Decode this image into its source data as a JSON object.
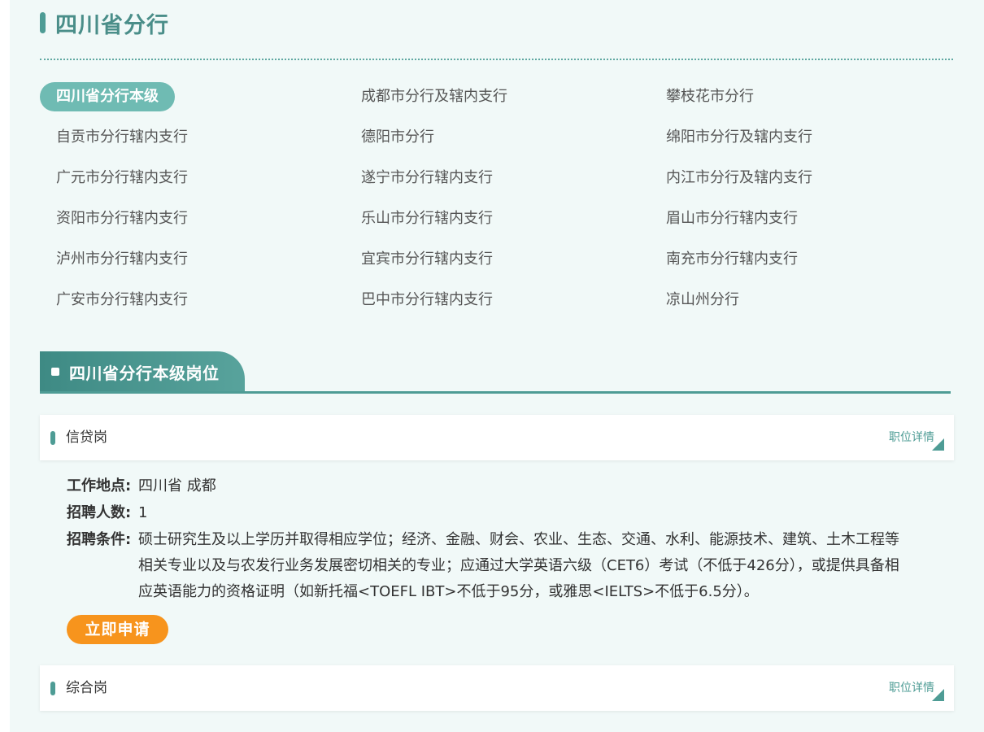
{
  "header": {
    "title": "四川省分行"
  },
  "branches": [
    {
      "label": "四川省分行本级",
      "active": true
    },
    {
      "label": "成都市分行及辖内支行"
    },
    {
      "label": "攀枝花市分行"
    },
    {
      "label": "自贡市分行辖内支行"
    },
    {
      "label": "德阳市分行"
    },
    {
      "label": "绵阳市分行及辖内支行"
    },
    {
      "label": "广元市分行辖内支行"
    },
    {
      "label": "遂宁市分行辖内支行"
    },
    {
      "label": "内江市分行及辖内支行"
    },
    {
      "label": "资阳市分行辖内支行"
    },
    {
      "label": "乐山市分行辖内支行"
    },
    {
      "label": "眉山市分行辖内支行"
    },
    {
      "label": "泸州市分行辖内支行"
    },
    {
      "label": "宜宾市分行辖内支行"
    },
    {
      "label": "南充市分行辖内支行"
    },
    {
      "label": "广安市分行辖内支行"
    },
    {
      "label": "巴中市分行辖内支行"
    },
    {
      "label": "凉山州分行"
    }
  ],
  "section": {
    "title": "四川省分行本级岗位"
  },
  "jobs": [
    {
      "title": "信贷岗",
      "detail_link": "职位详情",
      "location_label": "工作地点:",
      "location": "四川省 成都",
      "count_label": "招聘人数:",
      "count": "1",
      "requirements_label": "招聘条件:",
      "requirements": "硕士研究生及以上学历并取得相应学位；经济、金融、财会、农业、生态、交通、水利、能源技术、建筑、土木工程等相关专业以及与农发行业务发展密切相关的专业；应通过大学英语六级（CET6）考试（不低于426分），或提供具备相应英语能力的资格证明（如新托福<TOEFL IBT>不低于95分，或雅思<IELTS>不低于6.5分）。",
      "apply_label": "立即申请"
    },
    {
      "title": "综合岗",
      "detail_link": "职位详情"
    }
  ],
  "colors": {
    "accent": "#4e9c95",
    "active_pill": "#6fbbb3",
    "apply": "#f7941d",
    "background": "#f1f9f8"
  }
}
